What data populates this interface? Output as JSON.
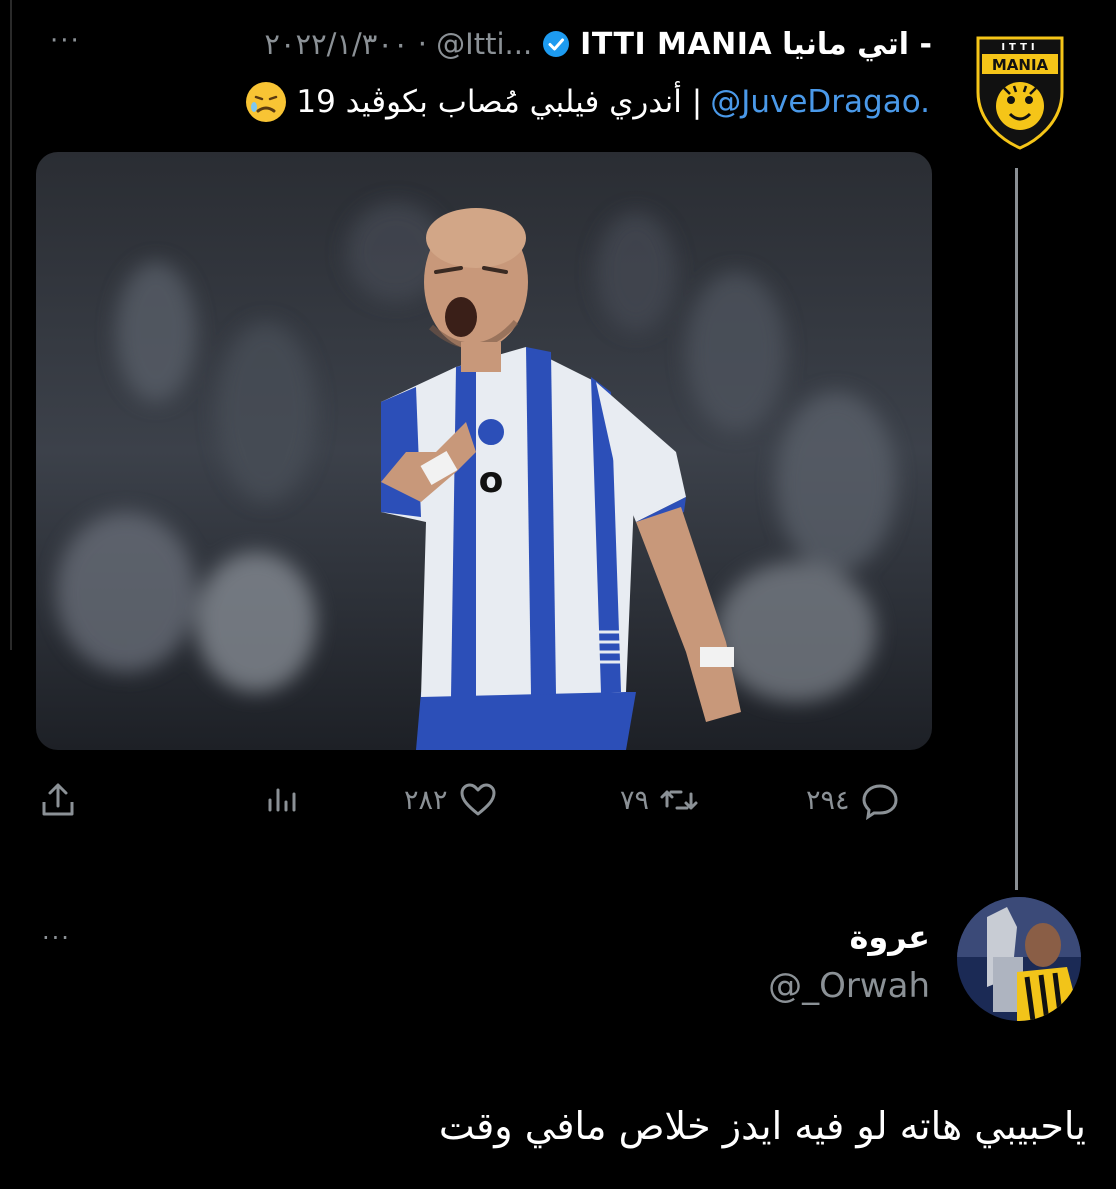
{
  "tweet": {
    "author_name_ar": "اتي مانيا -",
    "author_name_en": "ITTI MANIA",
    "handle_date": "٢٠٢٢/١/٣٠٠ · @Itti...",
    "more": "···",
    "text_mention": "@JuveDragao.",
    "text_body": "| أندري فيلبي مُصاب بكوڤيد 19",
    "avatar_label_top": "ITTI",
    "avatar_label_main": "MANIA",
    "avatar_brand_color": "#f5c518",
    "actions": {
      "replies": "٢٩٤",
      "retweets": "٧٩",
      "likes": "٢٨٢"
    }
  },
  "reply": {
    "name": "عروة",
    "handle": "@_Orwah",
    "more": "···",
    "text": "ياحبيبي هاته لو فيه ايدز خلاص مافي وقت"
  },
  "colors": {
    "background": "#000000",
    "text": "#e7e9ea",
    "muted": "#8b9196",
    "link": "#4a99e9",
    "verified": "#1d9bf0"
  }
}
